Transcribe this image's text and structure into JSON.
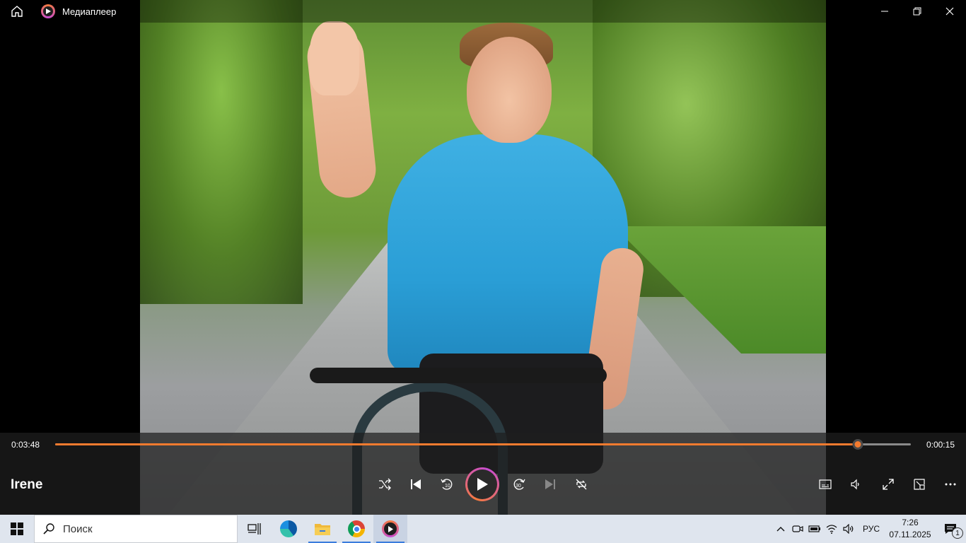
{
  "window": {
    "title": "Медиаплеер"
  },
  "player": {
    "track_title": "Irene",
    "time_current": "0:03:48",
    "time_remaining": "0:00:15",
    "progress_fraction": 0.938,
    "accent_color": "#f37b2f",
    "skip_back_seconds": "10",
    "skip_forward_seconds": "30"
  },
  "taskbar": {
    "search_placeholder": "Поиск",
    "apps": [
      "task-view-icon",
      "edge-icon",
      "file-explorer-icon",
      "chrome-icon",
      "media-player-icon"
    ],
    "language": "РУС",
    "time": "7:26",
    "date": "07.11.2025",
    "notification_count": "1"
  }
}
